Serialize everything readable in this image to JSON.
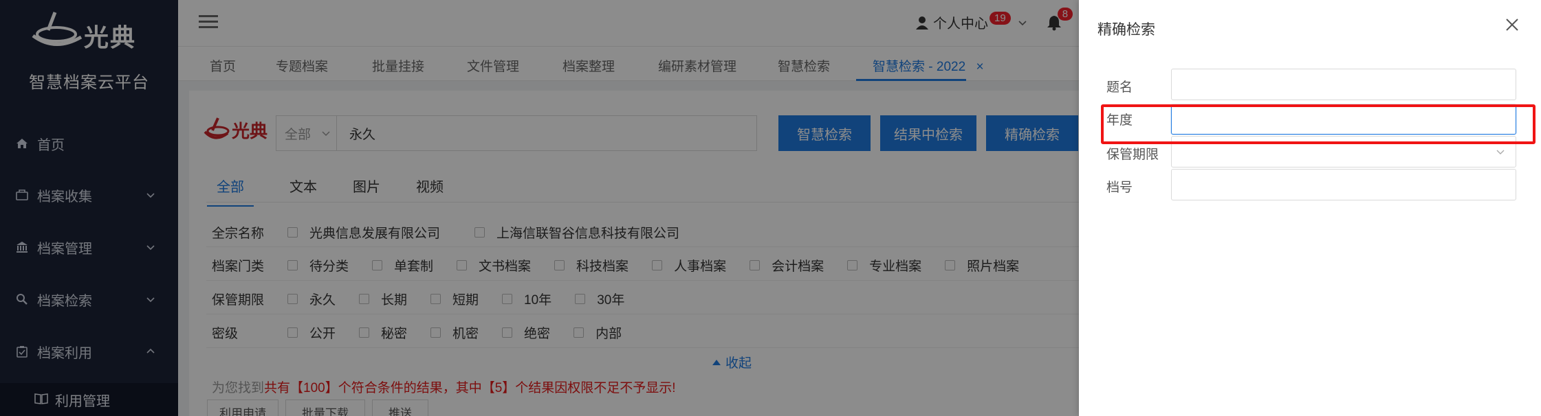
{
  "sidebar": {
    "logo_text": "光典",
    "platform": "智慧档案云平台",
    "items": [
      {
        "label": "首页",
        "icon": "home-icon"
      },
      {
        "label": "档案收集",
        "icon": "folder-icon"
      },
      {
        "label": "档案管理",
        "icon": "bank-icon"
      },
      {
        "label": "档案检索",
        "icon": "search-icon"
      },
      {
        "label": "档案利用",
        "icon": "clipboard-icon"
      }
    ],
    "sub_item": "利用管理"
  },
  "header": {
    "user_center": "个人中心",
    "user_badge": "19",
    "bell_badge": "8"
  },
  "tabs": [
    "首页",
    "专题档案",
    "批量挂接",
    "文件管理",
    "档案整理",
    "编研素材管理",
    "智慧检索",
    "智慧检索 - 2022"
  ],
  "search": {
    "scope": "全部",
    "value": "永久",
    "btn_smart": "智慧检索",
    "btn_within": "结果中检索",
    "btn_exact": "精确检索"
  },
  "subtabs": [
    "全部",
    "文本",
    "图片",
    "视频"
  ],
  "filters": {
    "fonds": {
      "label": "全宗名称",
      "options": [
        "光典信息发展有限公司",
        "上海信联智谷信息科技有限公司"
      ]
    },
    "category": {
      "label": "档案门类",
      "options": [
        "待分类",
        "单套制",
        "文书档案",
        "科技档案",
        "人事档案",
        "会计档案",
        "专业档案",
        "照片档案"
      ]
    },
    "retention": {
      "label": "保管期限",
      "options": [
        "永久",
        "长期",
        "短期",
        "10年",
        "30年"
      ]
    },
    "secret": {
      "label": "密级",
      "options": [
        "公开",
        "秘密",
        "机密",
        "绝密",
        "内部"
      ]
    }
  },
  "collapse_label": "收起",
  "result": {
    "prefix": "为您找到",
    "message": "共有【100】个符合条件的结果，其中【5】个结果因权限不足不予显示!"
  },
  "actions": [
    "利用申请",
    "批量下载",
    "推送"
  ],
  "drawer": {
    "title": "精确检索",
    "fields": [
      {
        "label": "题名",
        "value": ""
      },
      {
        "label": "年度",
        "value": ""
      },
      {
        "label": "保管期限",
        "value": ""
      },
      {
        "label": "档号",
        "value": ""
      }
    ]
  }
}
